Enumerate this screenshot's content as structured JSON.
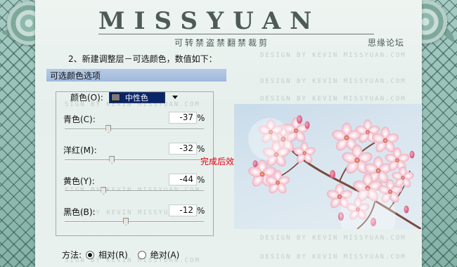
{
  "header": {
    "brand": "MISSYUAN",
    "subtitle": "可转禁盗禁翻禁裁剪",
    "forum": "思缘论坛"
  },
  "tutorial": {
    "step": "2、新建调整层－可选颜色，数值如下："
  },
  "watermark": {
    "text": "DESIGN BY KEVIN MISSYUAN.COM",
    "text_panel": "SIGN BY KEVIN MISSYUAN.COM"
  },
  "dialog": {
    "title": "可选颜色选项",
    "colors_label": "颜色(O):",
    "colors_value": "中性色",
    "sliders": [
      {
        "label": "青色(C):",
        "value": "-37",
        "unit": "%",
        "level": -37
      },
      {
        "label": "洋红(M):",
        "value": "-32",
        "unit": "%",
        "level": -32
      },
      {
        "label": "黄色(Y):",
        "value": "-44",
        "unit": "%",
        "level": -44
      },
      {
        "label": "黑色(B):",
        "value": "-12",
        "unit": "%",
        "level": -12
      }
    ],
    "method_label": "方法:",
    "method_relative": "相对(R)",
    "method_absolute": "绝对(A)",
    "method_selected": "relative"
  },
  "result": {
    "label": "完成后效果→"
  },
  "colors": {
    "selection": "#0a246a",
    "accent_red": "#e00010",
    "mesh": "#86b2a8"
  }
}
